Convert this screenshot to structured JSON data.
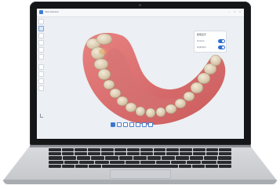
{
  "app": {
    "name": "Intra Scanner",
    "icons": {
      "logo": "app-logo-icon",
      "minimize": "minimize-icon",
      "maximize": "maximize-icon",
      "close": "close-icon"
    },
    "window_controls": [
      "–",
      "□",
      "×"
    ]
  },
  "panel": {
    "title": "模型显示",
    "rows": [
      {
        "label": "Texture",
        "state": "on"
      },
      {
        "label": "Highlight",
        "state": "on"
      }
    ]
  },
  "toolbar": {
    "tools": [
      "select-icon",
      "crop-icon",
      "lasso-icon",
      "erase-icon",
      "measure-icon",
      "mark-icon",
      "undo-icon",
      "redo-icon",
      "settings-icon",
      "help-icon"
    ],
    "active_index": 1
  },
  "view_buttons": {
    "items": [
      "front-view-icon",
      "back-view-icon",
      "left-view-icon",
      "right-view-icon",
      "top-view-icon",
      "bottom-view-icon",
      "fit-view-icon"
    ],
    "active_index": 0
  },
  "colors": {
    "gum": "#d96a6a",
    "teeth": "#d9ccb4",
    "accent": "#2f6fd0",
    "background": "#eceff3"
  }
}
